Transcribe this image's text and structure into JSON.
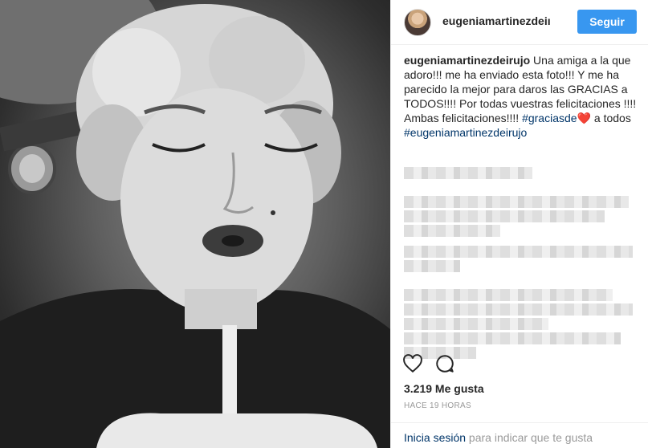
{
  "post": {
    "username": "eugeniamartinezdeirujo",
    "username_header": "eugeniamartinezdeiı",
    "follow_label": "Seguir",
    "caption": {
      "text_1": "Una amiga a la que adoro!!! me ha enviado esta foto!!! Y me ha parecido la mejor para daros las GRACIAS a TODOS!!!! Por todas vuestras felicitaciones !!!! Ambas felicitaciones!!!!",
      "hashtag_1": "#graciasde",
      "heart": "❤️",
      "text_2": "a todos",
      "hashtag_2": "#eugeniamartinezdeirujo"
    },
    "likes": "3.219 Me gusta",
    "time": "HACE 19 HORAS"
  },
  "footer": {
    "login_label": "Inicia sesión",
    "rest": " para indicar que te gusta"
  },
  "icons": {
    "like": "heart-icon",
    "comment": "comment-icon"
  },
  "colors": {
    "follow_button": "#3897f0",
    "hashtag": "#003569",
    "muted": "#999999"
  }
}
